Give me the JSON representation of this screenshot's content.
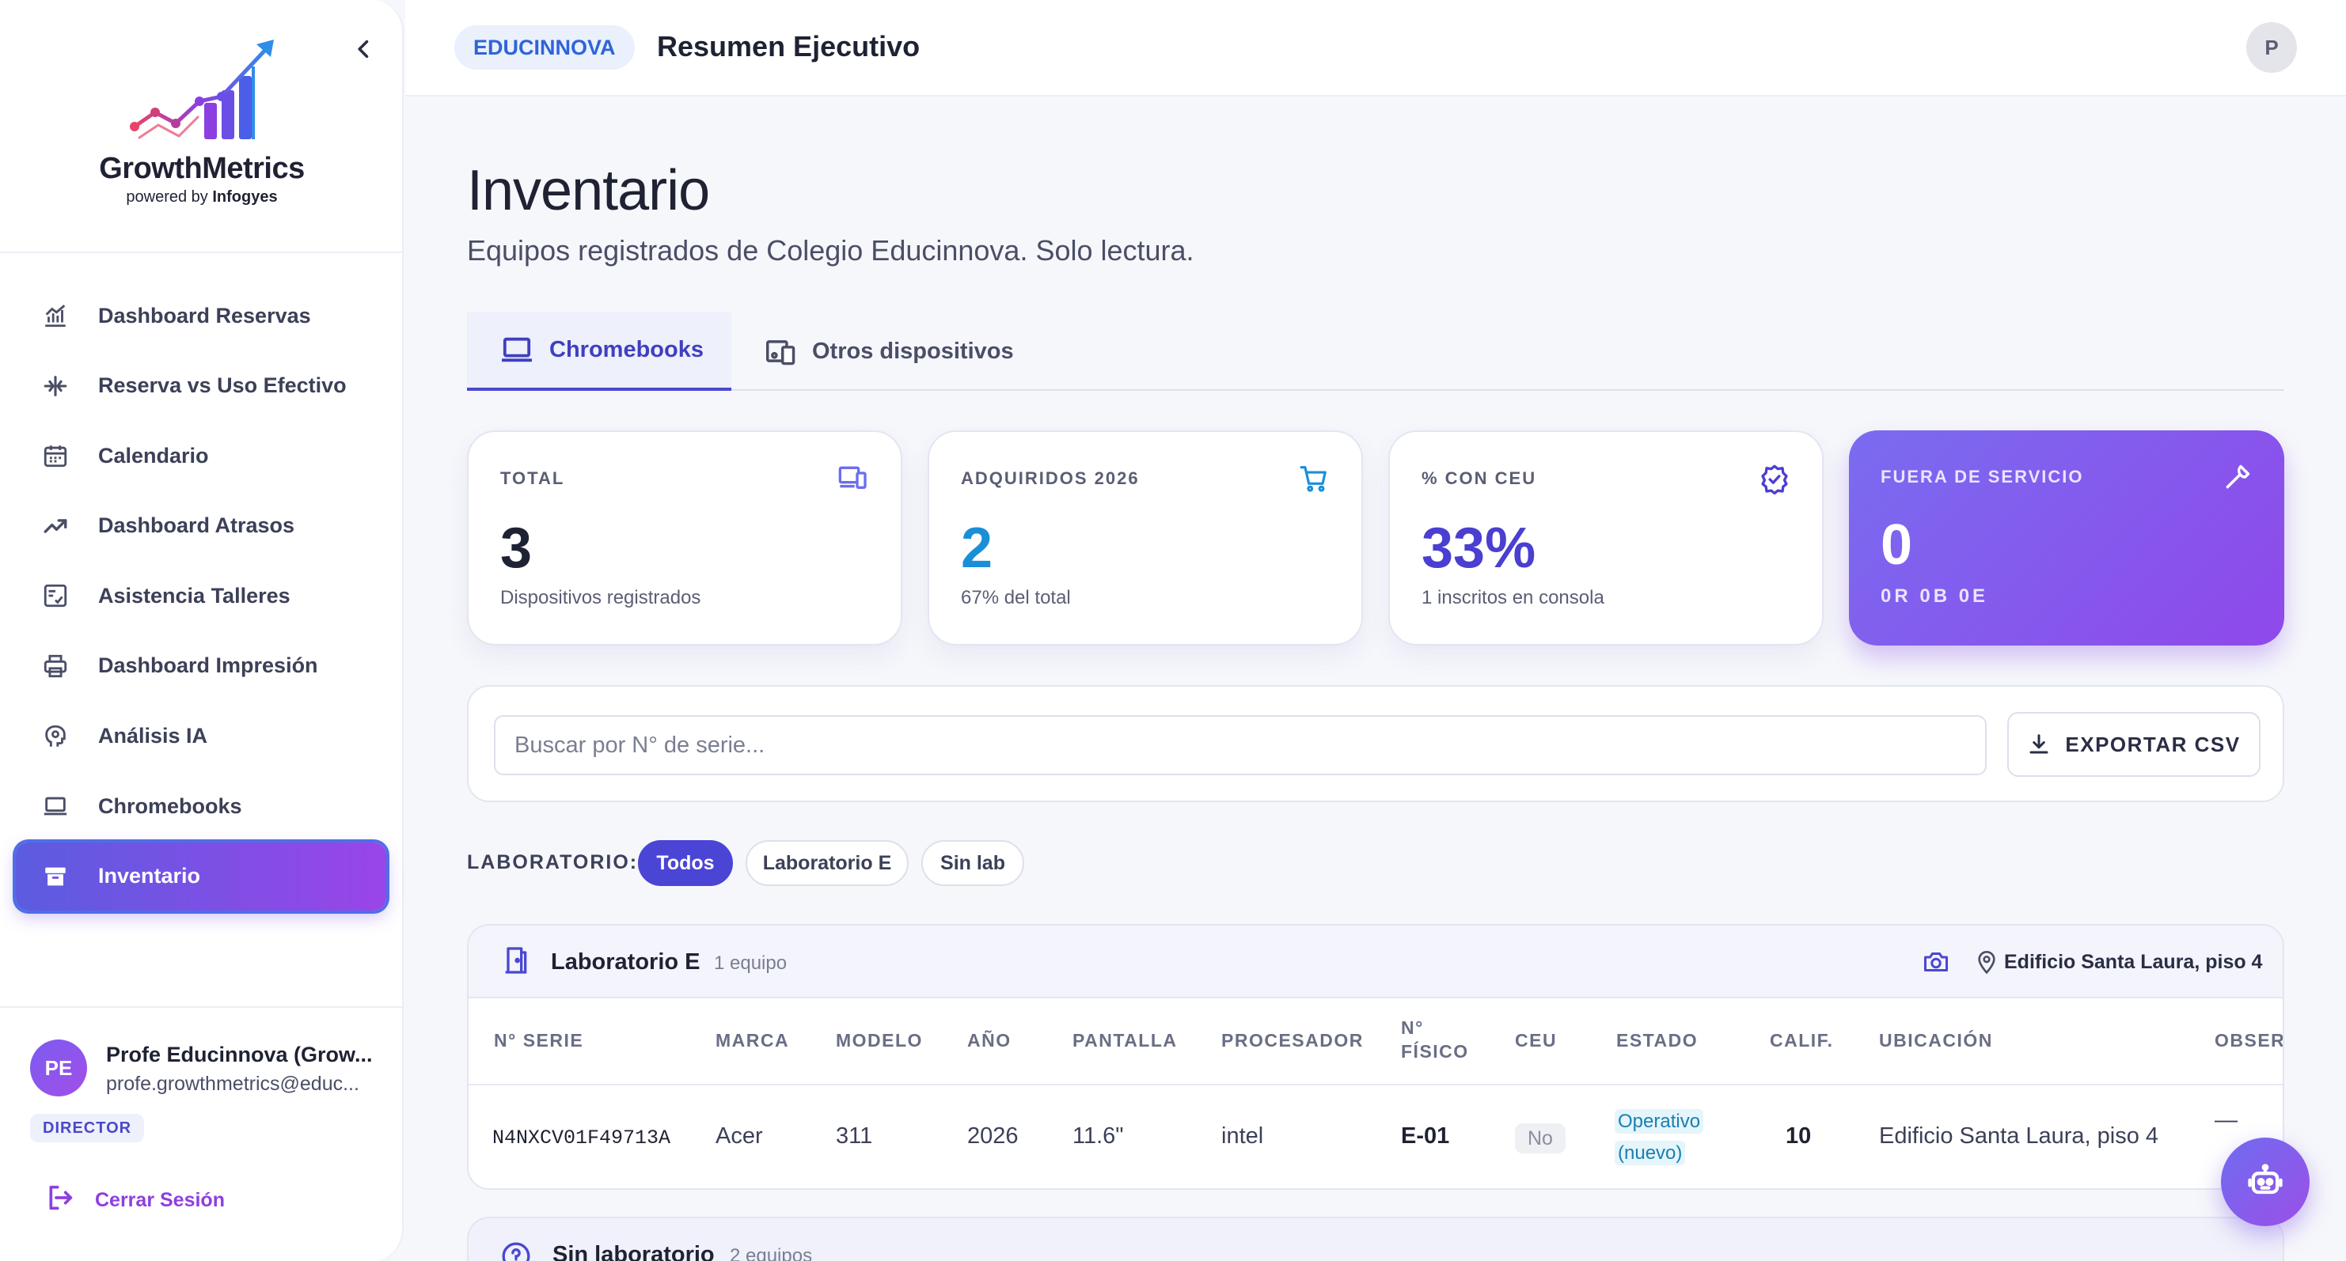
{
  "brand": {
    "name": "GrowthMetrics",
    "powered_prefix": "powered by",
    "powered_by": "Infogyes"
  },
  "sidebar": {
    "items": [
      {
        "label": "Dashboard Reservas",
        "icon": "bar-chart-icon"
      },
      {
        "label": "Reserva vs Uso Efectivo",
        "icon": "compare-arrows-icon"
      },
      {
        "label": "Calendario",
        "icon": "calendar-icon"
      },
      {
        "label": "Dashboard Atrasos",
        "icon": "trending-up-icon"
      },
      {
        "label": "Asistencia Talleres",
        "icon": "checklist-icon"
      },
      {
        "label": "Dashboard Impresión",
        "icon": "printer-icon"
      },
      {
        "label": "Análisis IA",
        "icon": "ai-head-icon"
      },
      {
        "label": "Chromebooks",
        "icon": "laptop-icon"
      },
      {
        "label": "Inventario",
        "icon": "archive-box-icon",
        "active": true
      }
    ],
    "user": {
      "initials": "PE",
      "name": "Profe Educinnova (Grow...",
      "email": "profe.growthmetrics@educ...",
      "role": "DIRECTOR"
    },
    "logout_label": "Cerrar Sesión"
  },
  "topbar": {
    "org": "EDUCINNOVA",
    "title": "Resumen Ejecutivo",
    "avatar": "P"
  },
  "page": {
    "title": "Inventario",
    "subtitle": "Equipos registrados de Colegio Educinnova. Solo lectura."
  },
  "tabs": [
    {
      "label": "Chromebooks",
      "active": true
    },
    {
      "label": "Otros dispositivos",
      "active": false
    }
  ],
  "stats": [
    {
      "label": "TOTAL",
      "value": "3",
      "note": "Dispositivos registrados",
      "color": "#1f2233",
      "icon": "devices-icon"
    },
    {
      "label": "ADQUIRIDOS 2026",
      "value": "2",
      "note": "67% del total",
      "color": "#1a8fd8",
      "icon": "cart-icon"
    },
    {
      "label": "% CON CEU",
      "value": "33%",
      "note": "1 inscritos en consola",
      "color": "#4a3fd0",
      "icon": "verified-badge-icon"
    },
    {
      "label": "FUERA DE SERVICIO",
      "value": "0",
      "note": "0R  0B  0E",
      "icon": "wrench-icon"
    }
  ],
  "search": {
    "placeholder": "Buscar por N° de serie...",
    "value": ""
  },
  "export_label": "EXPORTAR CSV",
  "filter": {
    "label": "LABORATORIO:",
    "options": [
      "Todos",
      "Laboratorio E",
      "Sin lab"
    ],
    "selected": "Todos"
  },
  "lab_group": {
    "name": "Laboratorio E",
    "count": "1 equipo",
    "location": "Edificio Santa Laura, piso 4",
    "columns": [
      "N° SERIE",
      "MARCA",
      "MODELO",
      "AÑO",
      "PANTALLA",
      "PROCESADOR",
      "N°\nFÍSICO",
      "CEU",
      "ESTADO",
      "CALIF.",
      "UBICACIÓN",
      "OBSERV"
    ],
    "rows": [
      {
        "serie": "N4NXCV01F49713A",
        "marca": "Acer",
        "modelo": "311",
        "anio": "2026",
        "pantalla": "11.6\"",
        "procesador": "intel",
        "fisico": "E-01",
        "ceu": "No",
        "estado_1": "Operativo",
        "estado_2": "(nuevo)",
        "calif": "10",
        "ubicacion": "Edificio Santa Laura, piso 4",
        "observ": "—"
      }
    ]
  },
  "next_group": {
    "name": "Sin laboratorio",
    "count": "2 equipos"
  },
  "colors": {
    "accent": "#4b45d6",
    "gradient_start": "#5b5ce0",
    "gradient_end": "#9a45e8"
  }
}
